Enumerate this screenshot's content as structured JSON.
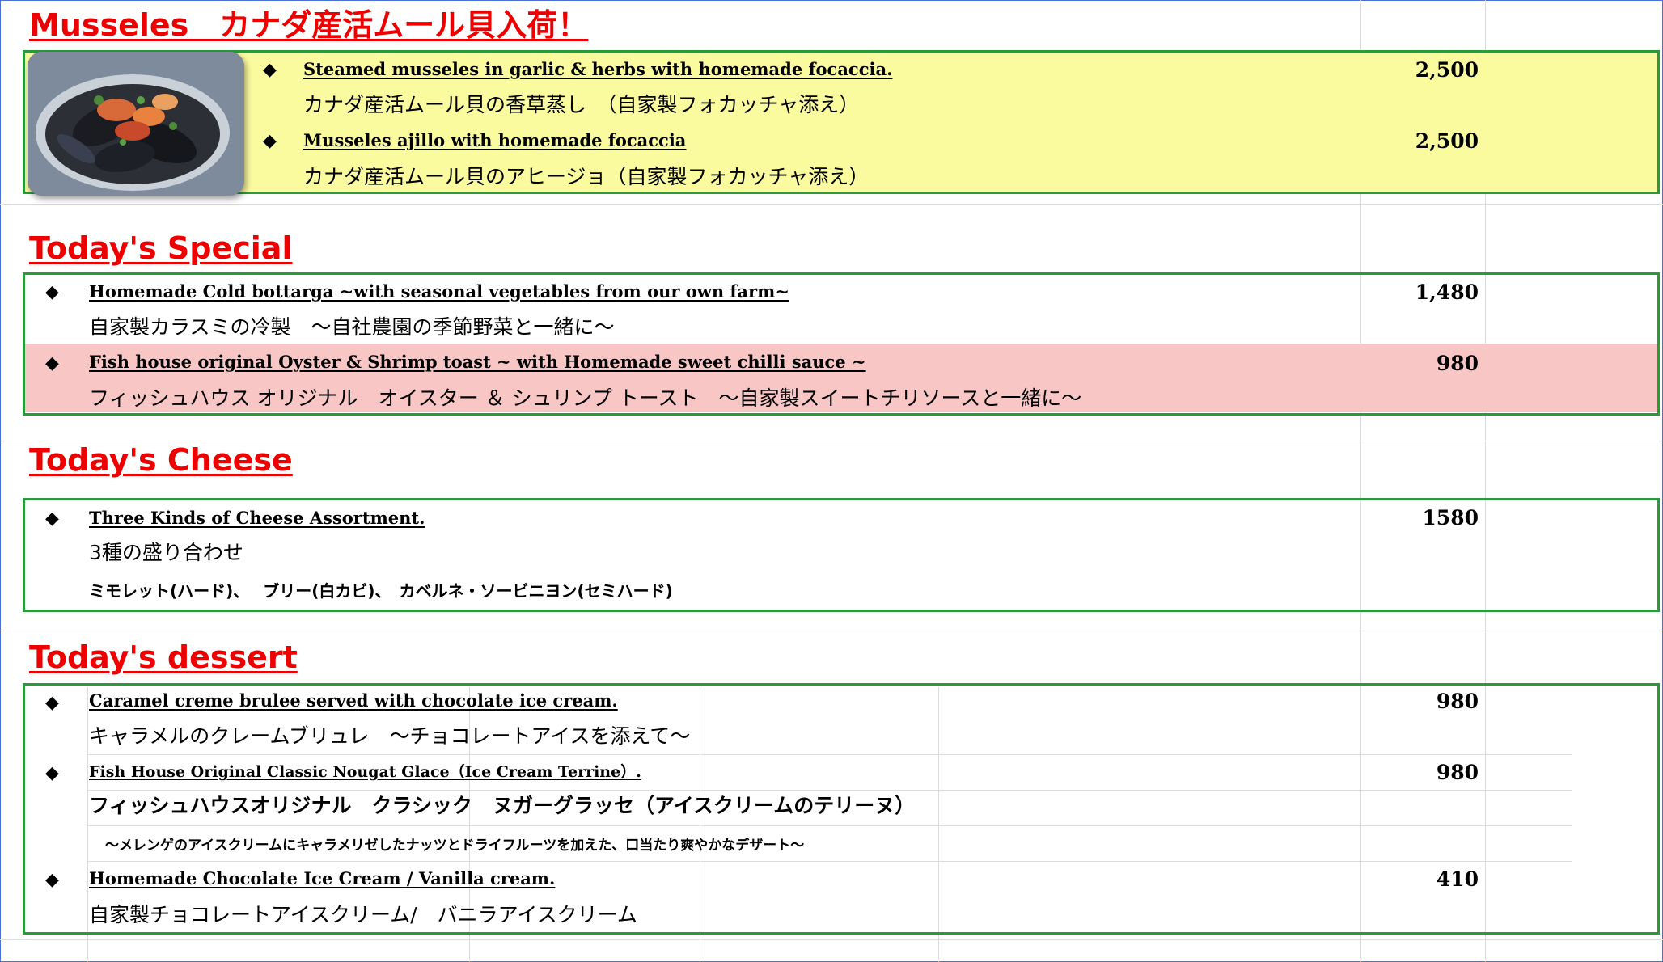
{
  "mussels": {
    "title": "Musseles　カナダ産活ムール貝入荷！",
    "items": [
      {
        "en": "Steamed musseles in garlic & herbs with homemade focaccia.",
        "jp": "カナダ産活ムール貝の香草蒸し　（自家製フォカッチャ添え）",
        "price": "2,500"
      },
      {
        "en": "Musseles ajillo with homemade focaccia",
        "jp": "カナダ産活ムール貝のアヒージョ（自家製フォカッチャ添え）",
        "price": "2,500"
      }
    ]
  },
  "special": {
    "title": "Today's Special",
    "items": [
      {
        "en": "Homemade Cold bottarga ~with seasonal vegetables from our own farm~",
        "jp": "自家製カラスミの冷製　～自社農園の季節野菜と一緒に～",
        "price": "1,480"
      },
      {
        "en": "Fish house original  Oyster & Shrimp toast ~ with Homemade sweet chilli sauce ~",
        "jp": "フィッシュハウス オリジナル　オイスター ＆ シュリンプ トースト　～自家製スイートチリソースと一緒に～",
        "price": "980"
      }
    ]
  },
  "cheese": {
    "title": " Today's Cheese",
    "items": [
      {
        "en": "Three Kinds of Cheese Assortment.",
        "jp": "3種の盛り合わせ",
        "detail": "ミモレット(ハード)、　 ブリー(白カビ)、　カベルネ・ソービニヨン(セミハード)",
        "price": "1580"
      }
    ]
  },
  "dessert": {
    "title": "Today's dessert",
    "items": [
      {
        "en": " Caramel creme brulee served with chocolate ice cream.",
        "jp": "キャラメルのクレームブリュレ　～チョコレートアイスを添えて～",
        "price": "980"
      },
      {
        "en": "Fish House Original Classic   Nougat Glace（Ice Cream Terrine）.",
        "jp": "フィッシュハウスオリジナル　クラシック　ヌガーグラッセ（アイスクリームのテリーヌ）",
        "detail": "～メレンゲのアイスクリームにキャラメリゼしたナッツとドライフルーツを加えた、口当たり爽やかなデザート～",
        "price": "980"
      },
      {
        "en": "Homemade Chocolate Ice Cream / Vanilla cream.",
        "jp": "自家製チョコレートアイスクリーム/　バニラアイスクリーム",
        "price": "410"
      }
    ]
  },
  "bullet": "◆",
  "colors": {
    "title_red": "#ee0000",
    "box_border": "#2a9a3a",
    "mussels_bg": "#fafa9e",
    "highlight_pink": "#f9c6c6"
  }
}
